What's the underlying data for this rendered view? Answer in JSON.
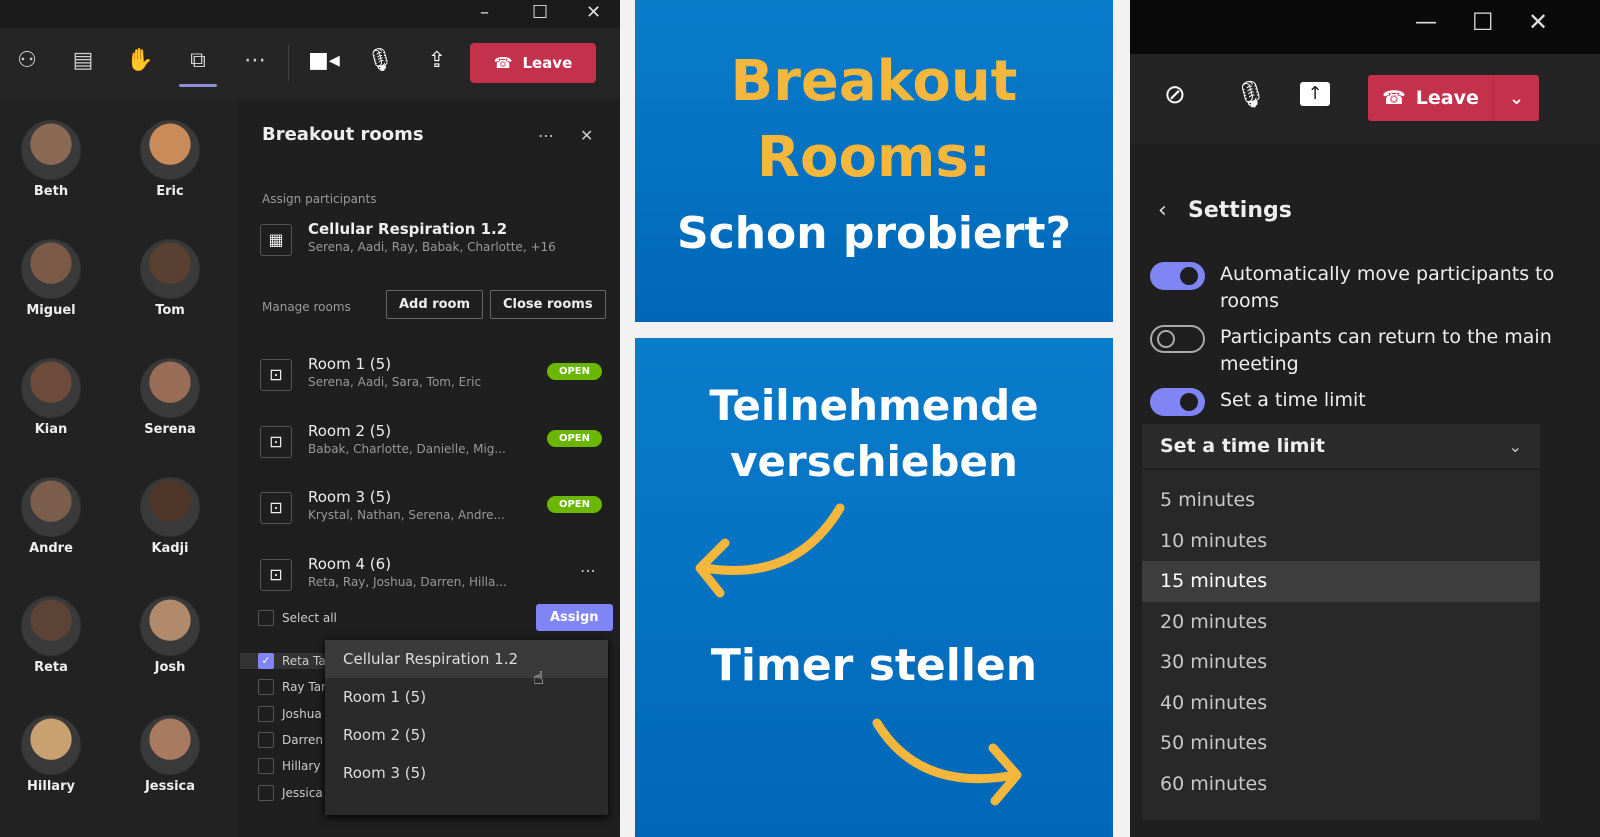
{
  "left_window": {
    "toolbar": {
      "icons": [
        "people-icon",
        "chat-icon",
        "raise-hand-icon",
        "breakout-rooms-icon",
        "more-icon",
        "camera-icon",
        "microphone-icon",
        "share-screen-icon"
      ],
      "leave_label": "Leave"
    },
    "gallery": [
      "Beth",
      "Eric",
      "Miguel",
      "Tom",
      "Kian",
      "Serena",
      "Andre",
      "Kadji",
      "Reta",
      "Josh",
      "Hillary",
      "Jessica"
    ],
    "panel": {
      "title": "Breakout rooms",
      "assign_label": "Assign participants",
      "meeting": {
        "name": "Cellular Respiration 1.2",
        "participants": "Serena, Aadi, Ray, Babak, Charlotte, +16"
      },
      "manage_label": "Manage rooms",
      "add_room": "Add room",
      "close_rooms": "Close rooms",
      "rooms": [
        {
          "name": "Room 1 (5)",
          "members": "Serena, Aadi, Sara, Tom, Eric",
          "status": "OPEN"
        },
        {
          "name": "Room 2 (5)",
          "members": "Babak, Charlotte, Danielle, Mig...",
          "status": "OPEN"
        },
        {
          "name": "Room 3 (5)",
          "members": "Krystal, Nathan, Serena, Andre...",
          "status": "OPEN"
        },
        {
          "name": "Room 4 (6)",
          "members": "Reta, Ray, Joshua, Darren, Hilla...",
          "status": ""
        }
      ],
      "select_all": "Select all",
      "assign_button": "Assign",
      "participants": [
        {
          "name": "Reta Ta",
          "checked": true
        },
        {
          "name": "Ray Tar",
          "checked": false
        },
        {
          "name": "Joshua",
          "checked": false
        },
        {
          "name": "Darren",
          "checked": false
        },
        {
          "name": "Hillary",
          "checked": false
        },
        {
          "name": "Jessica",
          "checked": false
        }
      ],
      "assign_menu": [
        "Cellular Respiration 1.2",
        "Room 1 (5)",
        "Room 2 (5)",
        "Room 3 (5)"
      ]
    }
  },
  "promo": {
    "title_line1": "Breakout",
    "title_line2": "Rooms:",
    "subtitle": "Schon probiert?",
    "feature1_line1": "Teilnehmende",
    "feature1_line2": "verschieben",
    "feature2": "Timer stellen",
    "colors": {
      "blue": "#0074c4",
      "yellow": "#f5b73b"
    }
  },
  "right_window": {
    "toolbar": {
      "icons": [
        "camera-off-icon",
        "microphone-icon",
        "share-icon"
      ],
      "leave_label": "Leave"
    },
    "settings_title": "Settings",
    "toggles": [
      {
        "label": "Automatically move participants to rooms",
        "on": true
      },
      {
        "label": "Participants can return to the main meeting",
        "on": false
      },
      {
        "label": "Set a time limit",
        "on": true
      }
    ],
    "time_limit_select": "Set a time limit",
    "time_options": [
      "5 minutes",
      "10 minutes",
      "15 minutes",
      "20 minutes",
      "30 minutes",
      "40 minutes",
      "50 minutes",
      "60 minutes"
    ],
    "selected_option": "15 minutes",
    "accent": "#7f85f5",
    "leave_color": "#c4314b"
  }
}
